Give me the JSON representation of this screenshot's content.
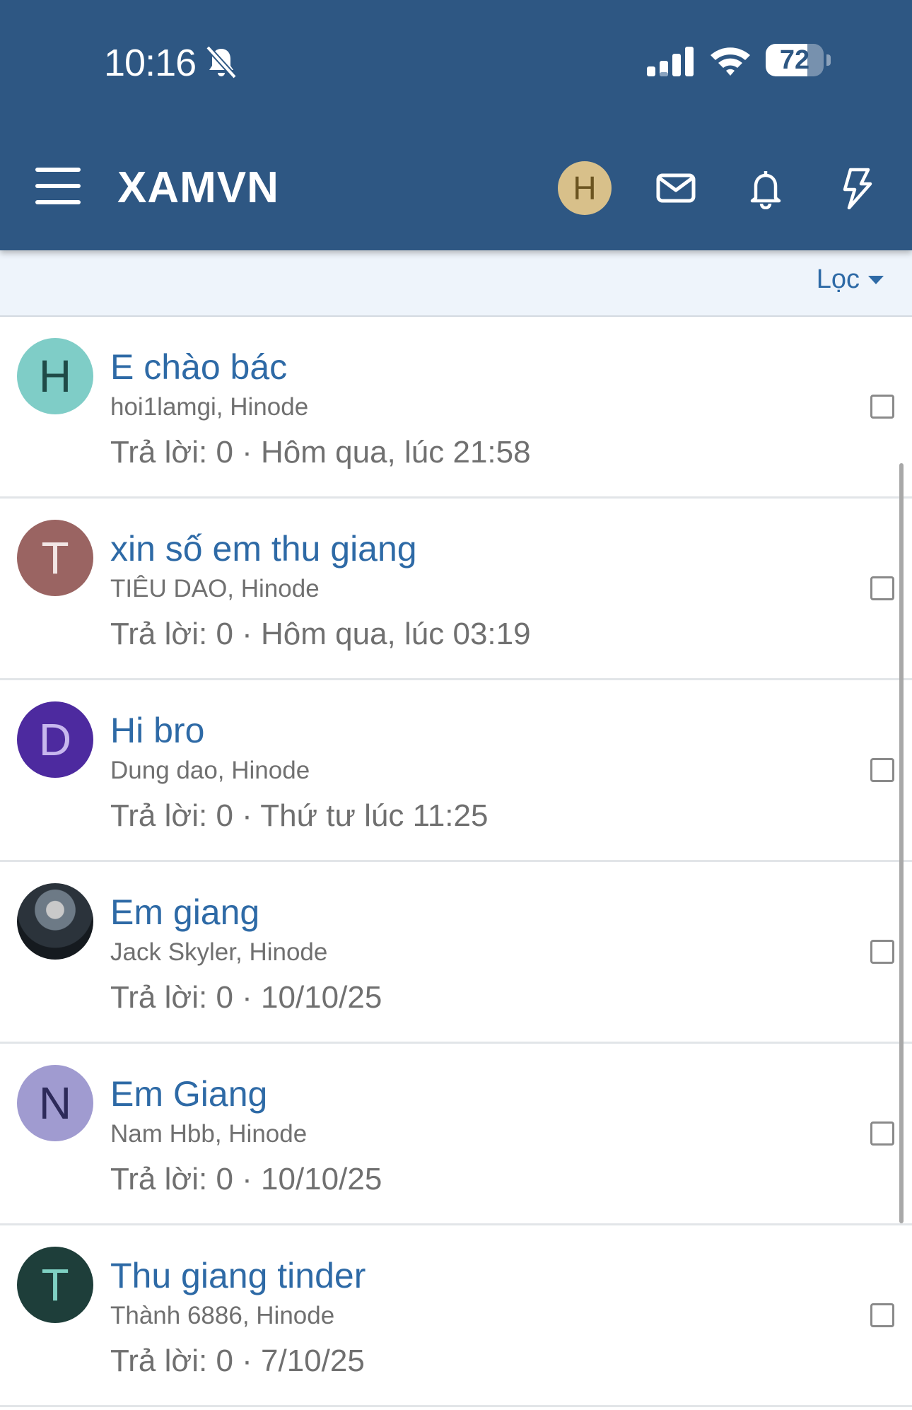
{
  "status_bar": {
    "time": "10:16",
    "mute_icon": "bell-slash-icon",
    "battery_text": "72",
    "battery_level": 0.72
  },
  "header": {
    "title": "XAMVN",
    "user_initial": "H",
    "icons": [
      "menu-icon",
      "mail-icon",
      "bell-icon",
      "lightning-icon"
    ],
    "colors": {
      "bar": "#2e5783",
      "avatar": "#d8c08a"
    }
  },
  "filter": {
    "label": "Lọc"
  },
  "threads": [
    {
      "initial": "H",
      "avatar_bg": "#7fcdc7",
      "avatar_fg": "#1f4a47",
      "title": "E chào bác",
      "participants": "hoi1lamgi, Hinode",
      "meta": "Trả lời: 0 · Hôm qua, lúc 21:58"
    },
    {
      "initial": "T",
      "avatar_bg": "#9a6462",
      "avatar_fg": "#f2e6e5",
      "title": "xin số em thu giang",
      "participants": "TIÊU DAO, Hinode",
      "meta": "Trả lời: 0 · Hôm qua, lúc 03:19"
    },
    {
      "initial": "D",
      "avatar_bg": "#4d2a9f",
      "avatar_fg": "#c7b7ee",
      "title": "Hi bro",
      "participants": "Dung dao, Hinode",
      "meta": "Trả lời: 0 · Thứ tư lúc 11:25"
    },
    {
      "initial": "",
      "avatar_bg": "#3c4750",
      "avatar_fg": "#ffffff",
      "photo": true,
      "title": "Em giang",
      "participants": "Jack Skyler, Hinode",
      "meta": "Trả lời: 0 · 10/10/25"
    },
    {
      "initial": "N",
      "avatar_bg": "#a09bd0",
      "avatar_fg": "#2d2a5a",
      "title": "Em Giang",
      "participants": "Nam Hbb, Hinode",
      "meta": "Trả lời: 0 · 10/10/25"
    },
    {
      "initial": "T",
      "avatar_bg": "#1e3e3a",
      "avatar_fg": "#7fd1c3",
      "title": "Thu giang tinder",
      "participants": "Thành 6886, Hinode",
      "meta": "Trả lời: 0 · 7/10/25"
    }
  ]
}
